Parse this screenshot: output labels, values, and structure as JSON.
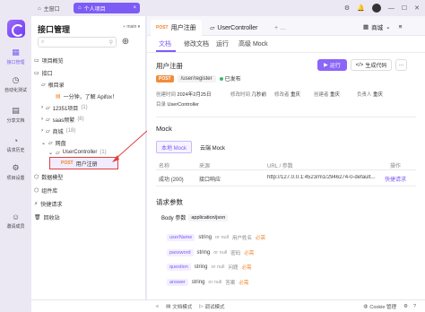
{
  "titlebar": {
    "home_label": "主窗口",
    "tab_label": "个人项目",
    "icons": [
      "gear-icon",
      "bell-icon",
      "avatar",
      "minimize-icon",
      "maximize-icon",
      "close-icon"
    ]
  },
  "rail": {
    "items": [
      {
        "label": "接口管理",
        "icon": "api-icon",
        "active": true
      },
      {
        "label": "自动化测试",
        "icon": "test-icon"
      },
      {
        "label": "分享文档",
        "icon": "share-icon"
      },
      {
        "label": "请求历史",
        "icon": "history-icon"
      },
      {
        "label": "项目设置",
        "icon": "settings-icon"
      },
      {
        "label": "邀请成员",
        "icon": "invite-icon"
      }
    ]
  },
  "tree": {
    "title": "接口管理",
    "branch": "main",
    "search_placeholder": "",
    "rows": [
      {
        "text": "项目概览",
        "icon": "overview-icon",
        "indent": 0
      },
      {
        "text": "接口",
        "icon": "api-folder-icon",
        "indent": 0,
        "expanded": true
      },
      {
        "text": "根目录",
        "icon": "folder-icon",
        "indent": 1
      },
      {
        "text": "一分钟，了解 Apifox！",
        "icon": "doc-icon",
        "indent": 2
      },
      {
        "text": "12351项目",
        "count": "(1)",
        "icon": "folder-icon",
        "indent": 1
      },
      {
        "text": "saas频繁",
        "count": "(8)",
        "icon": "folder-icon",
        "indent": 1
      },
      {
        "text": "商城",
        "count": "(18)",
        "icon": "folder-icon",
        "indent": 1
      },
      {
        "text": "网盘",
        "icon": "folder-icon",
        "indent": 1,
        "expanded": true
      },
      {
        "text": "UserController",
        "count": "(1)",
        "icon": "folder-icon",
        "indent": 2
      },
      {
        "text": "用户注册",
        "method": "POST",
        "indent": 3,
        "selected": true
      },
      {
        "text": "数据模型",
        "icon": "model-icon",
        "indent": 0
      },
      {
        "text": "组件库",
        "icon": "component-icon",
        "indent": 0
      },
      {
        "text": "快捷请求",
        "icon": "quick-icon",
        "indent": 0
      },
      {
        "text": "回收站",
        "icon": "trash-icon",
        "indent": 0
      }
    ]
  },
  "doc_tabs": [
    {
      "method": "POST",
      "label": "用户注册",
      "active": true
    },
    {
      "label": "UserController",
      "icon": "folder-icon"
    }
  ],
  "env": {
    "label": "商城"
  },
  "subtabs": [
    "文档",
    "修改文档",
    "运行",
    "高级 Mock"
  ],
  "api": {
    "name": "用户注册",
    "method": "POST",
    "path": "/user/register",
    "status": "已发布",
    "run_label": "运行",
    "gen_label": "生成代码",
    "more_label": "...",
    "created_time_label": "创建时间",
    "created_time": "2024年2月25日",
    "modified_label": "修改时间",
    "modified_time": "几秒前",
    "modifier_label": "修改者",
    "modifier": "重庆",
    "creator_label": "创建者",
    "creator": "重庆",
    "owner_label": "负责人",
    "owner": "重庆",
    "dir_label": "目录",
    "dir": "UserController"
  },
  "mock": {
    "title": "Mock",
    "tabs": [
      "本地 Mock",
      "云端 Mock"
    ],
    "headers": [
      "名称",
      "来源",
      "URL / 参数",
      "操作"
    ],
    "row": {
      "name": "成功 (200)",
      "source": "接口响应",
      "url": "http://127.0.0.1:4523/m1/2946274-0-default...",
      "action": "快捷请求"
    }
  },
  "request": {
    "title": "请求参数",
    "body_label": "Body 参数",
    "body_type": "application/json",
    "fields": [
      {
        "name": "userName",
        "type": "string",
        "null": "or null",
        "desc": "用户姓名",
        "required": "必需"
      },
      {
        "name": "password",
        "type": "string",
        "null": "or null",
        "desc": "密码",
        "required": "必需"
      },
      {
        "name": "question",
        "type": "string",
        "null": "or null",
        "desc": "问题",
        "required": "必需"
      },
      {
        "name": "answer",
        "type": "string",
        "null": "or null",
        "desc": "答案",
        "required": "必需"
      }
    ]
  },
  "bottom": {
    "doc_mode": "文档模式",
    "debug_mode": "调试模式",
    "cookie": "Cookie 管理"
  },
  "colors": {
    "accent": "#7c5cf5",
    "post": "#f08c3c",
    "annotation": "#e04040"
  }
}
